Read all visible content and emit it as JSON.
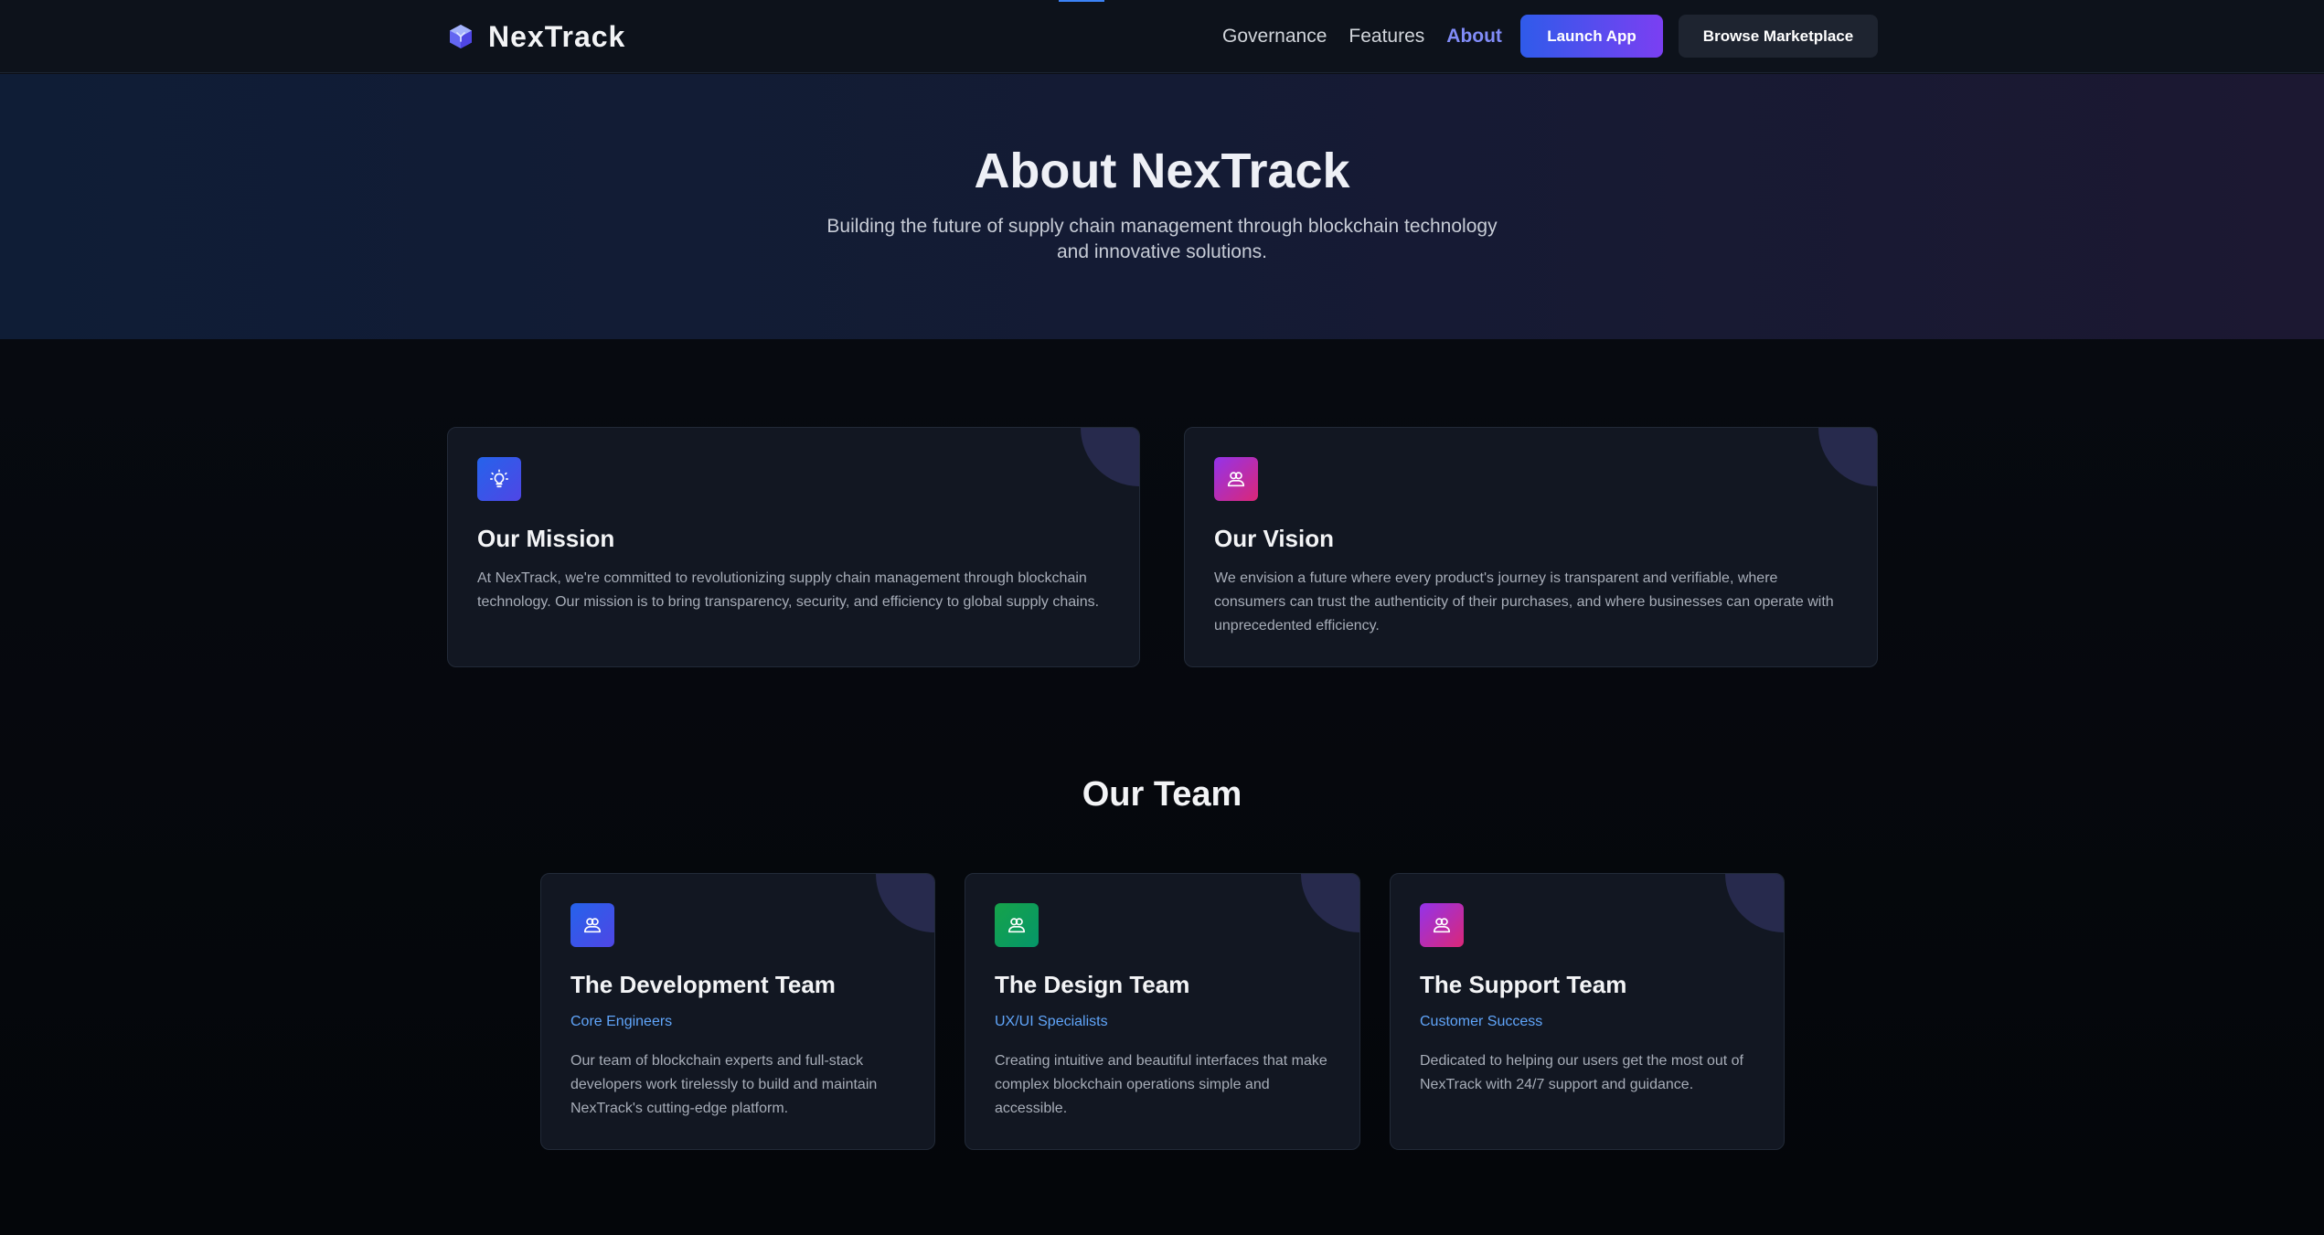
{
  "brand": {
    "name": "NexTrack",
    "icon": "cube-icon"
  },
  "nav": {
    "links": [
      {
        "label": "Governance",
        "active": false
      },
      {
        "label": "Features",
        "active": false
      },
      {
        "label": "About",
        "active": true
      }
    ],
    "launch_label": "Launch App",
    "browse_label": "Browse Marketplace"
  },
  "hero": {
    "title": "About NexTrack",
    "subtitle": "Building the future of supply chain management through blockchain technology and innovative solutions."
  },
  "mission": {
    "icon": "lightbulb-icon",
    "title": "Our Mission",
    "text": "At NexTrack, we're committed to revolutionizing supply chain management through blockchain technology. Our mission is to bring transparency, security, and efficiency to global supply chains."
  },
  "vision": {
    "icon": "users-icon",
    "title": "Our Vision",
    "text": "We envision a future where every product's journey is transparent and verifiable, where consumers can trust the authenticity of their purchases, and where businesses can operate with unprecedented efficiency."
  },
  "team": {
    "title": "Our Team",
    "members": [
      {
        "icon": "users-icon",
        "title": "The Development Team",
        "role": "Core Engineers",
        "text": "Our team of blockchain experts and full-stack developers work tirelessly to build and maintain NexTrack's cutting-edge platform."
      },
      {
        "icon": "users-icon",
        "title": "The Design Team",
        "role": "UX/UI Specialists",
        "text": "Creating intuitive and beautiful interfaces that make complex blockchain operations simple and accessible."
      },
      {
        "icon": "users-icon",
        "title": "The Support Team",
        "role": "Customer Success",
        "text": "Dedicated to helping our users get the most out of NexTrack with 24/7 support and guidance."
      }
    ]
  },
  "colors": {
    "accent": "#818cf8",
    "role": "#60a5fa",
    "card_bg": "#121722"
  }
}
